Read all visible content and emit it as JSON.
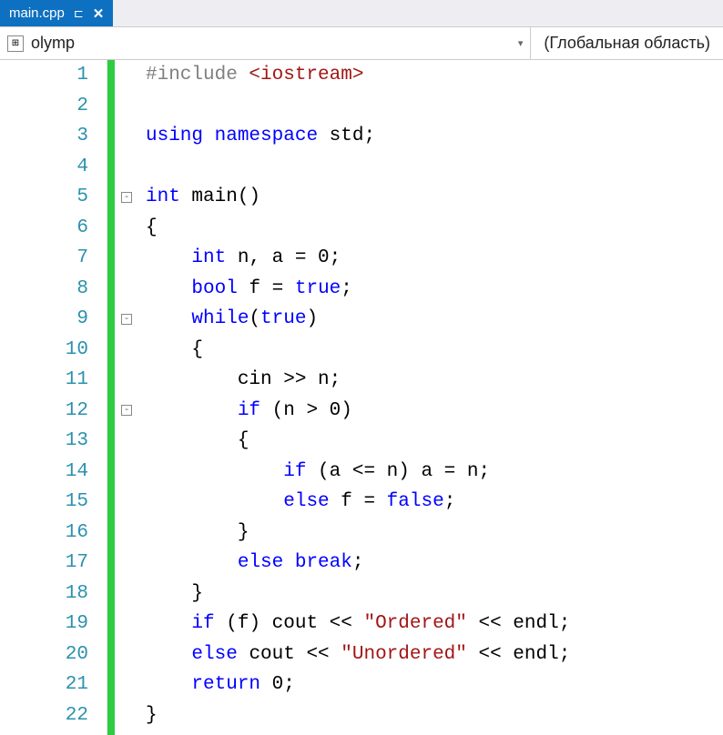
{
  "tab": {
    "name": "main.cpp",
    "pin_glyph": "⊏",
    "close_glyph": "✕"
  },
  "scope": {
    "icon_glyph": "⊞",
    "name": "olymp",
    "arrow": "▾",
    "global_label": "(Глобальная область)"
  },
  "lines": [
    {
      "n": "1",
      "fold": "",
      "tokens": [
        {
          "t": "#include ",
          "c": "preproc"
        },
        {
          "t": "<iostream>",
          "c": "include-angle"
        }
      ]
    },
    {
      "n": "2",
      "fold": "",
      "tokens": []
    },
    {
      "n": "3",
      "fold": "",
      "tokens": [
        {
          "t": "using ",
          "c": "kw"
        },
        {
          "t": "namespace ",
          "c": "kw"
        },
        {
          "t": "std;",
          "c": "ident"
        }
      ]
    },
    {
      "n": "4",
      "fold": "",
      "tokens": []
    },
    {
      "n": "5",
      "fold": "-",
      "tokens": [
        {
          "t": "int ",
          "c": "type"
        },
        {
          "t": "main()",
          "c": "ident"
        }
      ]
    },
    {
      "n": "6",
      "fold": "",
      "tokens": [
        {
          "t": "{",
          "c": "punct"
        }
      ]
    },
    {
      "n": "7",
      "fold": "",
      "tokens": [
        {
          "t": "    ",
          "c": "ident"
        },
        {
          "t": "int ",
          "c": "type"
        },
        {
          "t": "n, a = 0;",
          "c": "ident"
        }
      ]
    },
    {
      "n": "8",
      "fold": "",
      "tokens": [
        {
          "t": "    ",
          "c": "ident"
        },
        {
          "t": "bool ",
          "c": "type"
        },
        {
          "t": "f = ",
          "c": "ident"
        },
        {
          "t": "true",
          "c": "kw"
        },
        {
          "t": ";",
          "c": "punct"
        }
      ]
    },
    {
      "n": "9",
      "fold": "-",
      "tokens": [
        {
          "t": "    ",
          "c": "ident"
        },
        {
          "t": "while",
          "c": "kw"
        },
        {
          "t": "(",
          "c": "punct"
        },
        {
          "t": "true",
          "c": "kw"
        },
        {
          "t": ")",
          "c": "punct"
        }
      ]
    },
    {
      "n": "10",
      "fold": "",
      "tokens": [
        {
          "t": "    {",
          "c": "punct"
        }
      ]
    },
    {
      "n": "11",
      "fold": "",
      "tokens": [
        {
          "t": "        cin >> n;",
          "c": "ident"
        }
      ]
    },
    {
      "n": "12",
      "fold": "-",
      "tokens": [
        {
          "t": "        ",
          "c": "ident"
        },
        {
          "t": "if ",
          "c": "kw"
        },
        {
          "t": "(n > 0)",
          "c": "ident"
        }
      ]
    },
    {
      "n": "13",
      "fold": "",
      "tokens": [
        {
          "t": "        {",
          "c": "punct"
        }
      ]
    },
    {
      "n": "14",
      "fold": "",
      "tokens": [
        {
          "t": "            ",
          "c": "ident"
        },
        {
          "t": "if ",
          "c": "kw"
        },
        {
          "t": "(a <= n) a = n;",
          "c": "ident"
        }
      ]
    },
    {
      "n": "15",
      "fold": "",
      "tokens": [
        {
          "t": "            ",
          "c": "ident"
        },
        {
          "t": "else ",
          "c": "kw"
        },
        {
          "t": "f = ",
          "c": "ident"
        },
        {
          "t": "false",
          "c": "kw"
        },
        {
          "t": ";",
          "c": "punct"
        }
      ]
    },
    {
      "n": "16",
      "fold": "",
      "tokens": [
        {
          "t": "        }",
          "c": "punct"
        }
      ]
    },
    {
      "n": "17",
      "fold": "",
      "tokens": [
        {
          "t": "        ",
          "c": "ident"
        },
        {
          "t": "else ",
          "c": "kw"
        },
        {
          "t": "break",
          "c": "kw"
        },
        {
          "t": ";",
          "c": "punct"
        }
      ]
    },
    {
      "n": "18",
      "fold": "",
      "tokens": [
        {
          "t": "    }",
          "c": "punct"
        }
      ]
    },
    {
      "n": "19",
      "fold": "",
      "tokens": [
        {
          "t": "    ",
          "c": "ident"
        },
        {
          "t": "if ",
          "c": "kw"
        },
        {
          "t": "(f) cout << ",
          "c": "ident"
        },
        {
          "t": "\"Ordered\"",
          "c": "str"
        },
        {
          "t": " << endl;",
          "c": "ident"
        }
      ]
    },
    {
      "n": "20",
      "fold": "",
      "tokens": [
        {
          "t": "    ",
          "c": "ident"
        },
        {
          "t": "else ",
          "c": "kw"
        },
        {
          "t": "cout << ",
          "c": "ident"
        },
        {
          "t": "\"Unordered\"",
          "c": "str"
        },
        {
          "t": " << endl;",
          "c": "ident"
        }
      ]
    },
    {
      "n": "21",
      "fold": "",
      "tokens": [
        {
          "t": "    ",
          "c": "ident"
        },
        {
          "t": "return ",
          "c": "kw"
        },
        {
          "t": "0;",
          "c": "ident"
        }
      ]
    },
    {
      "n": "22",
      "fold": "",
      "tokens": [
        {
          "t": "}",
          "c": "punct"
        }
      ]
    }
  ]
}
